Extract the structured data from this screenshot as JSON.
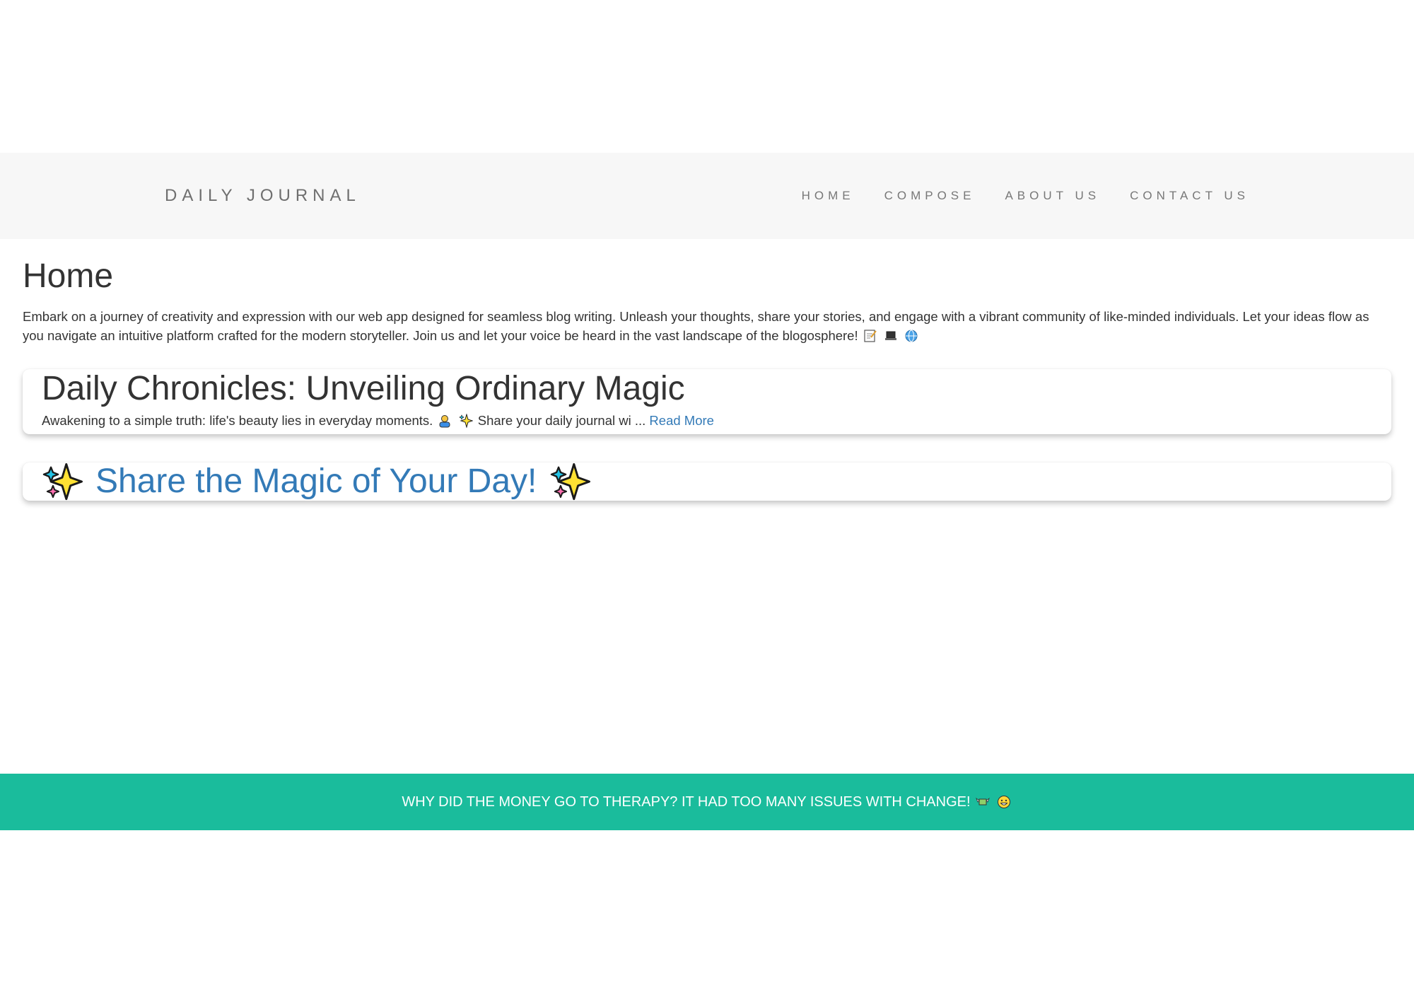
{
  "navbar": {
    "brand": "DAILY JOURNAL",
    "links": [
      "HOME",
      "COMPOSE",
      "ABOUT US",
      "CONTACT US"
    ]
  },
  "main": {
    "title": "Home",
    "intro": "Embark on a journey of creativity and expression with our web app designed for seamless blog writing. Unleash your thoughts, share your stories, and engage with a vibrant community of like-minded individuals. Let your ideas flow as you navigate an intuitive platform crafted for the modern storyteller. Join us and let your voice be heard in the vast landscape of the blogosphere!",
    "intro_icons": [
      "memo-icon",
      "laptop-icon",
      "globe-icon"
    ]
  },
  "posts": [
    {
      "title": "Daily Chronicles: Unveiling Ordinary Magic",
      "excerpt_start": "Awakening to a simple truth: life's beauty lies in everyday moments.",
      "excerpt_icons": [
        "person-icon",
        "sparkles-icon"
      ],
      "excerpt_end": "Share your daily journal wi ...",
      "read_more": "Read More"
    }
  ],
  "share": {
    "label": "Share the Magic of Your Day!",
    "icon": "sparkles-icon"
  },
  "footer": {
    "text": "WHY DID THE MONEY GO TO THERAPY? IT HAD TOO MANY ISSUES WITH CHANGE!",
    "icons": [
      "money-wings-icon",
      "grin-icon"
    ]
  },
  "colors": {
    "navbar_bg": "#f7f7f7",
    "link_blue": "#337ab7",
    "footer_bg": "#1abc9c"
  }
}
